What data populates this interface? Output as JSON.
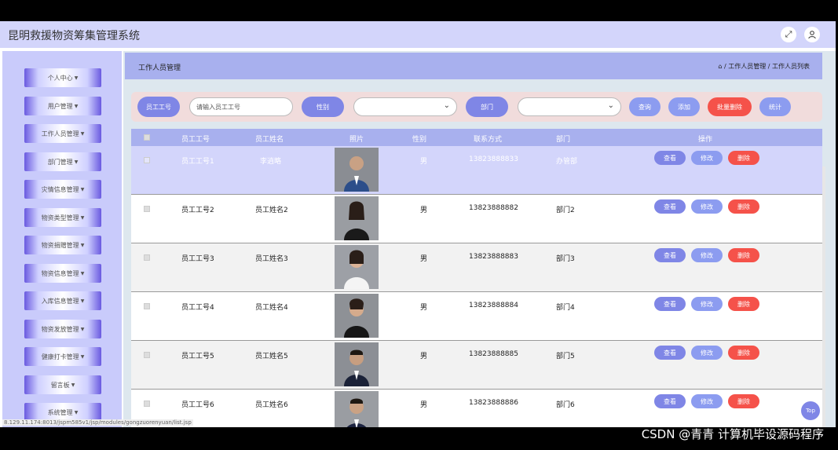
{
  "app": {
    "title": "昆明救援物资筹集管理系统"
  },
  "topbar": {
    "icons": [
      "fullscreen-icon",
      "user-icon"
    ]
  },
  "sidebar": {
    "items": [
      {
        "label": "个人中心"
      },
      {
        "label": "用户管理"
      },
      {
        "label": "工作人员管理"
      },
      {
        "label": "部门管理"
      },
      {
        "label": "灾情信息管理"
      },
      {
        "label": "物资类型管理"
      },
      {
        "label": "物资捐赠管理"
      },
      {
        "label": "物资信息管理"
      },
      {
        "label": "入库信息管理"
      },
      {
        "label": "物资发放管理"
      },
      {
        "label": "健康打卡管理"
      },
      {
        "label": "留言板"
      },
      {
        "label": "系统管理"
      }
    ]
  },
  "header": {
    "title": "工作人员管理",
    "breadcrumb": "/ 工作人员管理 / 工作人员列表"
  },
  "search": {
    "emp_id_label": "员工工号",
    "emp_id_placeholder": "请输入员工工号",
    "gender_label": "性别",
    "dept_label": "部门",
    "query_label": "查询",
    "add_label": "添加",
    "batch_delete_label": "批量删除",
    "stats_label": "统计"
  },
  "table": {
    "columns": [
      "员工工号",
      "员工姓名",
      "照片",
      "性别",
      "联系方式",
      "部门",
      "操作"
    ],
    "rows": [
      {
        "emp_id": "员工工号1",
        "name": "李逍略",
        "gender": "男",
        "phone": "13823888833",
        "dept": "办管部"
      },
      {
        "emp_id": "员工工号2",
        "name": "员工姓名2",
        "gender": "男",
        "phone": "13823888882",
        "dept": "部门2"
      },
      {
        "emp_id": "员工工号3",
        "name": "员工姓名3",
        "gender": "男",
        "phone": "13823888883",
        "dept": "部门3"
      },
      {
        "emp_id": "员工工号4",
        "name": "员工姓名4",
        "gender": "男",
        "phone": "13823888884",
        "dept": "部门4"
      },
      {
        "emp_id": "员工工号5",
        "name": "员工姓名5",
        "gender": "男",
        "phone": "13823888885",
        "dept": "部门5"
      },
      {
        "emp_id": "员工工号6",
        "name": "员工姓名6",
        "gender": "男",
        "phone": "13823888886",
        "dept": "部门6"
      }
    ],
    "actions": {
      "view": "查看",
      "edit": "修改",
      "delete": "删除"
    }
  },
  "top_button": {
    "label": "Top"
  },
  "status_url": "8.129.11.174:8013/jspm585v1/jsp/modules/gongzuorenyuan/list.jsp",
  "watermark": "CSDN @青青 计算机毕设源码程序",
  "colors": {
    "accent": "#7f86e6",
    "header": "#a8b0ee",
    "danger": "#f5524a"
  }
}
